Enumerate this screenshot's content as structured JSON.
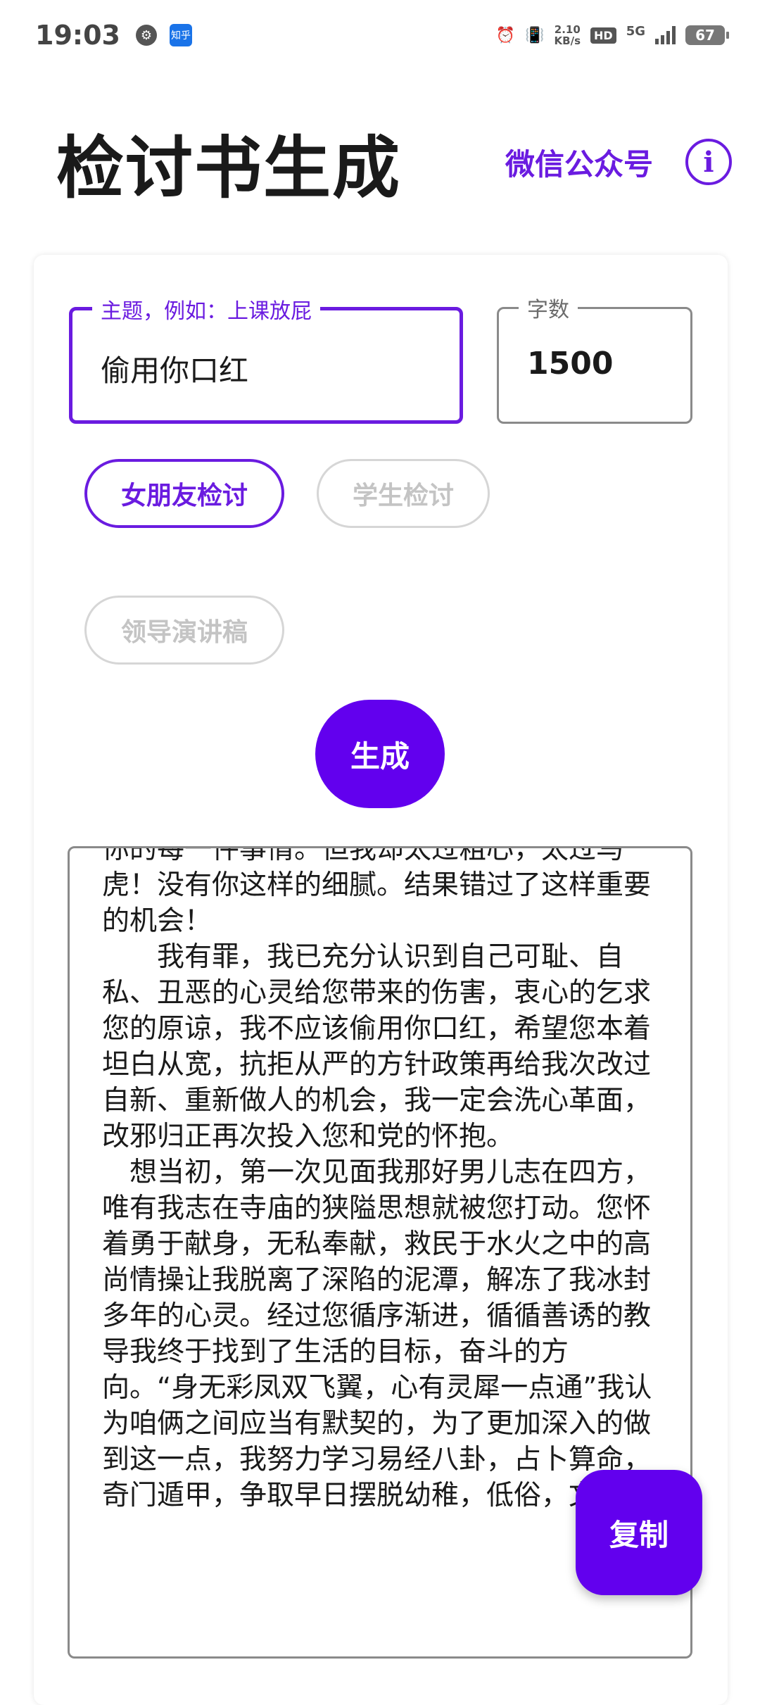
{
  "status_bar": {
    "time": "19:03",
    "net_speed_value": "2.10",
    "net_speed_unit": "KB/s",
    "hd_label": "HD",
    "network_label": "5G",
    "battery": "67",
    "notification_icons": [
      "settings-icon",
      "zhihu-icon"
    ],
    "zhihu_label": "知乎"
  },
  "header": {
    "title": "检讨书生成",
    "wechat_label": "微信公众号",
    "info_glyph": "i"
  },
  "form": {
    "topic": {
      "label": "主题，例如：上课放屁",
      "value": "偷用你口红"
    },
    "word_count": {
      "label": "字数",
      "value": "1500"
    },
    "chips": [
      {
        "label": "女朋友检讨",
        "selected": true
      },
      {
        "label": "学生检讨",
        "selected": false
      },
      {
        "label": "领导演讲稿",
        "selected": false
      }
    ],
    "generate_label": "生成"
  },
  "output": {
    "text": "你的每一件事情。但我却太过粗心，太过马虎！没有你这样的细腻。结果错过了这样重要的机会！\n　　我有罪，我已充分认识到自己可耻、自私、丑恶的心灵给您带来的伤害，衷心的乞求您的原谅，我不应该偷用你口红，希望您本着坦白从宽，抗拒从严的方针政策再给我次改过自新、重新做人的机会，我一定会洗心革面，改邪归正再次投入您和党的怀抱。\n　想当初，第一次见面我那好男儿志在四方，唯有我志在寺庙的狭隘思想就被您打动。您怀着勇于献身，无私奉献，救民于水火之中的高尚情操让我脱离了深陷的泥潭，解冻了我冰封多年的心灵。经过您循序渐进，循循善诱的教导我终于找到了生活的目标，奋斗的方向。“身无彩凤双飞翼，心有灵犀一点通”我认为咱俩之间应当有默契的，为了更加深入的做到这一点，我努力学习易经八卦，占卜算命，奇门遁甲，争取早日摆脱幼稚，低俗，文",
    "copy_label": "复制"
  },
  "colors": {
    "accent": "#6200ee",
    "accent_text": "#6a1be0",
    "border_gray": "#8a8a8a",
    "disabled_gray": "#c4c4c4"
  }
}
